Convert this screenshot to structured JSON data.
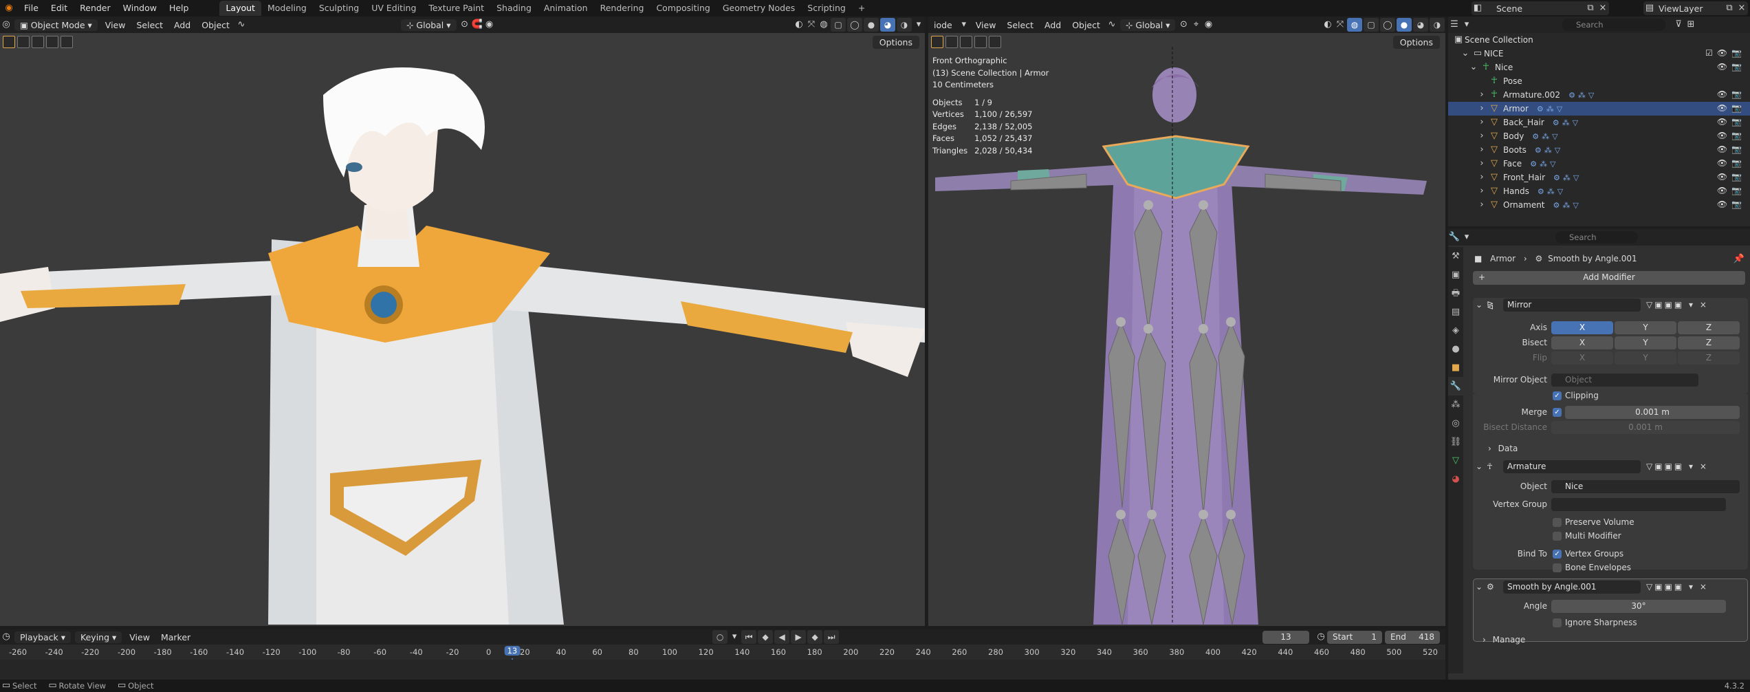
{
  "topbar": {
    "menus": [
      "File",
      "Edit",
      "Render",
      "Window",
      "Help"
    ],
    "workspaces": [
      "Layout",
      "Modeling",
      "Sculpting",
      "UV Editing",
      "Texture Paint",
      "Shading",
      "Animation",
      "Rendering",
      "Compositing",
      "Geometry Nodes",
      "Scripting"
    ],
    "active_workspace": "Layout",
    "add_tab": "+",
    "scene": "Scene",
    "view_layer": "ViewLayer"
  },
  "viewport_left": {
    "mode": "Object Mode",
    "menus": [
      "View",
      "Select",
      "Add",
      "Object"
    ],
    "orientation": "Global",
    "options": "Options"
  },
  "viewport_right": {
    "mode": "iode",
    "menus": [
      "View",
      "Select",
      "Add",
      "Object"
    ],
    "orientation": "Global",
    "options": "Options",
    "overlay": {
      "view_name": "Front Orthographic",
      "collection": "(13) Scene Collection | Armor",
      "scale": "10 Centimeters",
      "stats": [
        [
          "Objects",
          "1 / 9"
        ],
        [
          "Vertices",
          "1,100 / 26,597"
        ],
        [
          "Edges",
          "2,138 / 52,005"
        ],
        [
          "Faces",
          "1,052 / 25,437"
        ],
        [
          "Triangles",
          "2,028 / 50,434"
        ]
      ]
    }
  },
  "timeline": {
    "menus": [
      "Playback",
      "Keying",
      "View",
      "Marker"
    ],
    "current_frame": "13",
    "start_label": "Start",
    "start": "1",
    "end_label": "End",
    "end": "418",
    "ticks": [
      "-260",
      "-240",
      "-220",
      "-200",
      "-180",
      "-160",
      "-140",
      "-120",
      "-100",
      "-80",
      "-60",
      "-40",
      "-20",
      "0",
      "20",
      "40",
      "60",
      "80",
      "100",
      "120",
      "140",
      "160",
      "180",
      "200",
      "220",
      "240",
      "260",
      "280",
      "300",
      "320",
      "340",
      "360",
      "380",
      "400",
      "420",
      "440",
      "460",
      "480",
      "500",
      "520"
    ]
  },
  "statusbar": {
    "select": "Select",
    "rotate": "Rotate View",
    "object": "Object",
    "version": "4.3.2"
  },
  "outliner": {
    "search_placeholder": "Search",
    "root": "Scene Collection",
    "collection": "NICE",
    "items": [
      {
        "name": "Nice",
        "indent": 2
      },
      {
        "name": "Pose",
        "indent": 3
      },
      {
        "name": "Armature.002",
        "indent": 3
      },
      {
        "name": "Armor",
        "indent": 3,
        "selected": true
      },
      {
        "name": "Back_Hair",
        "indent": 3
      },
      {
        "name": "Body",
        "indent": 3
      },
      {
        "name": "Boots",
        "indent": 3
      },
      {
        "name": "Face",
        "indent": 3
      },
      {
        "name": "Front_Hair",
        "indent": 3
      },
      {
        "name": "Hands",
        "indent": 3
      },
      {
        "name": "Ornament",
        "indent": 3
      }
    ]
  },
  "properties": {
    "search_placeholder": "Search",
    "breadcrumb_object": "Armor",
    "breadcrumb_modifier": "Smooth by Angle.001",
    "add_modifier": "Add Modifier",
    "mirror": {
      "name": "Mirror",
      "axis_label": "Axis",
      "bisect_label": "Bisect",
      "flip_label": "Flip",
      "x": "X",
      "y": "Y",
      "z": "Z",
      "mirror_object_label": "Mirror Object",
      "mirror_object_placeholder": "Object",
      "clipping": "Clipping",
      "merge_label": "Merge",
      "merge_value": "0.001 m",
      "bisect_distance_label": "Bisect Distance",
      "bisect_distance_value": "0.001 m",
      "data": "Data"
    },
    "armature": {
      "name": "Armature",
      "object_label": "Object",
      "object_value": "Nice",
      "vertex_group_label": "Vertex Group",
      "preserve_volume": "Preserve Volume",
      "multi_modifier": "Multi Modifier",
      "bind_to_label": "Bind To",
      "vertex_groups": "Vertex Groups",
      "bone_envelopes": "Bone Envelopes"
    },
    "smooth": {
      "name": "Smooth by Angle.001",
      "angle_label": "Angle",
      "angle_value": "30°",
      "ignore_sharpness": "Ignore Sharpness",
      "manage": "Manage"
    }
  },
  "colors": {
    "accent": "#4772b3",
    "selected_row": "#334d80",
    "orange": "#e3a84b"
  }
}
